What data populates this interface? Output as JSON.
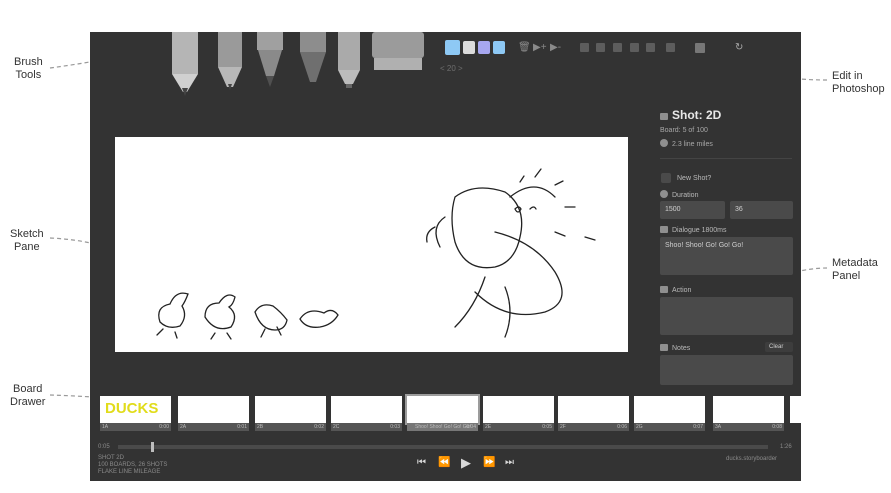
{
  "callouts": {
    "brush_tools": "Brush\nTools",
    "sketch_pane": "Sketch\nPane",
    "board_drawer": "Board\nDrawer",
    "edit_in_photoshop": "Edit in\nPhotoshop",
    "metadata_panel": "Metadata\nPanel"
  },
  "toolbar": {
    "colors": [
      "#8ec9f5",
      "#dcdcdc",
      "#a7a7f0",
      "#8ec9f5"
    ],
    "page_indicator": "< 20 >"
  },
  "metadata": {
    "shot_title": "Shot: 2D",
    "board": "Board: 5 of 100",
    "line_miles": "2.3 line miles",
    "new_shot_label": "New Shot?",
    "duration_label": "Duration",
    "duration_ms": "1500",
    "duration_frames": "36",
    "dialogue_label": "Dialogue 1800ms",
    "dialogue_text": "Shoo! Shoo! Go! Go! Go!",
    "action_label": "Action",
    "notes_label": "Notes",
    "clear_label": "Clear"
  },
  "drawer": {
    "thumbs": [
      {
        "label": "1A",
        "time": "0:00",
        "text": "DUCKS"
      },
      {
        "label": "2A",
        "time": "0:01",
        "text": ""
      },
      {
        "label": "2B",
        "time": "0:02",
        "text": ""
      },
      {
        "label": "2C",
        "time": "0:03",
        "text": ""
      },
      {
        "label": "2D",
        "time": "0:04",
        "text": "Shoo! Shoo! Go! Go! Go!"
      },
      {
        "label": "2E",
        "time": "0:05",
        "text": "TALKING!"
      },
      {
        "label": "2F",
        "time": "0:06",
        "text": "then he go go go!"
      },
      {
        "label": "2G",
        "time": "0:07",
        "text": ""
      },
      {
        "label": "3A",
        "time": "0:08",
        "text": ""
      },
      {
        "label": "3B",
        "time": "",
        "text": ""
      }
    ]
  },
  "timeline": {
    "start": "0:05",
    "end": "1:26",
    "info_line1": "SHOT 2D",
    "info_line2": "100 BOARDS, 26 SHOTS",
    "info_line3": "FLAKE LINE MILEAGE",
    "url": "ducks.storyboarder"
  }
}
